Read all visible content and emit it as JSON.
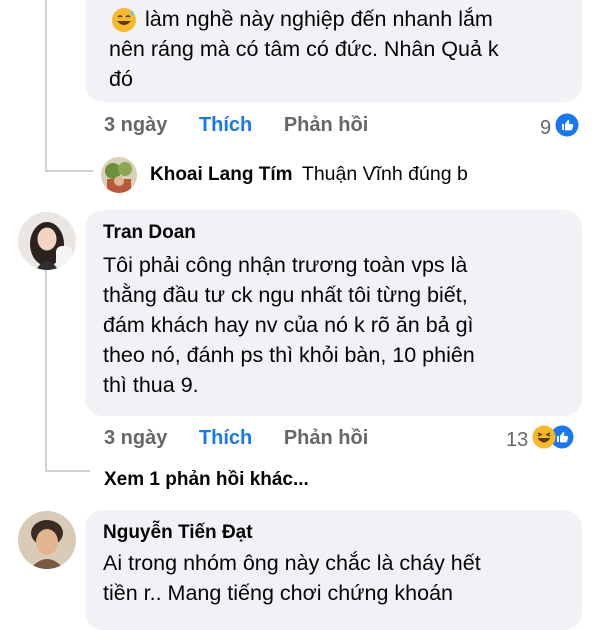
{
  "comments": [
    {
      "text": "làm nghề này nghiệp đến nhanh lắm\nnên ráng mà có tâm có đức. Nhân Quả k\nđó",
      "time": "3 ngày",
      "like_label": "Thích",
      "reply_label": "Phản hồi",
      "reaction_count": "9",
      "reaction_icons": [
        "like-icon"
      ]
    },
    {
      "author": "Tran Doan",
      "text": "Tôi phải công nhận trương toàn vps là\nthằng đầu tư ck ngu nhất tôi từng biết,\nđám khách hay nv của nó k rõ ăn bả gì\ntheo nó, đánh ps thì khỏi bàn, 10 phiên\nthì thua 9.",
      "time": "3 ngày",
      "like_label": "Thích",
      "reply_label": "Phản hồi",
      "reaction_count": "13",
      "reaction_icons": [
        "haha-icon",
        "like-icon"
      ]
    },
    {
      "author": "Nguyễn Tiến Đạt",
      "text": "Ai trong nhóm ông này chắc là cháy hết\ntiền r.. Mang tiếng chơi chứng khoán"
    }
  ],
  "reply_preview": {
    "author": "Khoai Lang Tím",
    "text": "Thuận Vĩnh đúng b"
  },
  "more_replies_label": "Xem 1 phản hồi khác...",
  "colors": {
    "bubble": "#f0f2f5",
    "like_blue": "#1877f2",
    "meta_gray": "#65676b",
    "haha_yellow": "#f7b928"
  }
}
